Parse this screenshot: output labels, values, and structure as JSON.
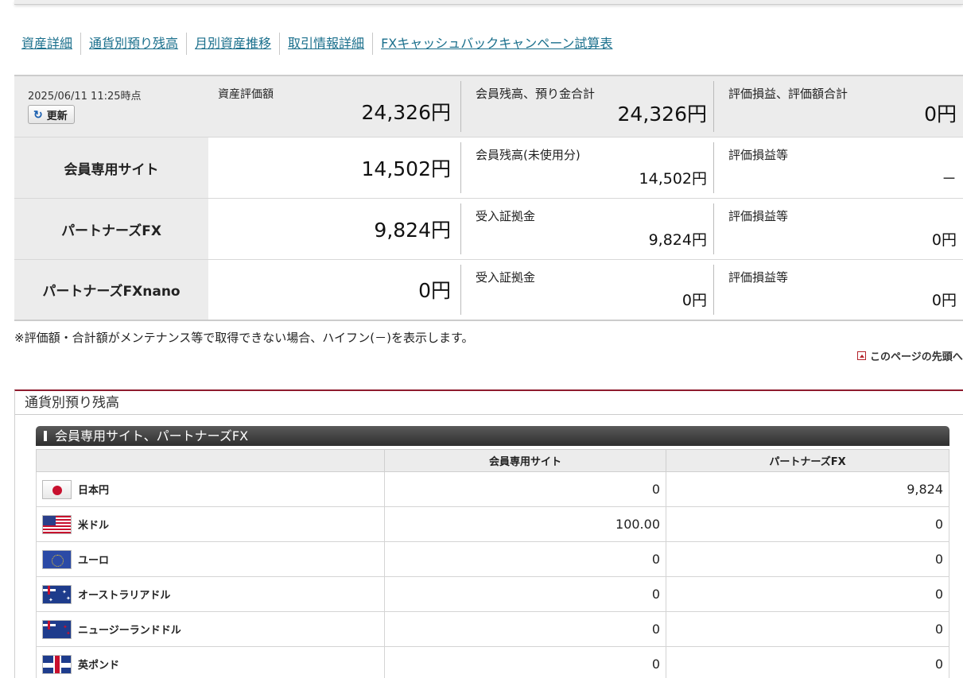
{
  "subnav": [
    "資産詳細",
    "通貨別預り残高",
    "月別資産推移",
    "取引情報詳細",
    "FXキャッシュバックキャンペーン試算表"
  ],
  "summary": {
    "timestamp": "2025/06/11 11:25時点",
    "refresh_label": "更新",
    "total_label": "資産評価額",
    "total_value": "24,326円",
    "balance_label": "会員残高、預り金合計",
    "balance_value": "24,326円",
    "pl_label": "評価損益、評価額合計",
    "pl_value": "0円",
    "rows": [
      {
        "name": "会員専用サイト",
        "value": "14,502円",
        "sub_label": "会員残高(未使用分)",
        "sub_value": "14,502円",
        "pl_label": "評価損益等",
        "pl_value": "－"
      },
      {
        "name": "パートナーズFX",
        "value": "9,824円",
        "sub_label": "受入証拠金",
        "sub_value": "9,824円",
        "pl_label": "評価損益等",
        "pl_value": "0円"
      },
      {
        "name": "パートナーズFXnano",
        "value": "0円",
        "sub_label": "受入証拠金",
        "sub_value": "0円",
        "pl_label": "評価損益等",
        "pl_value": "0円"
      }
    ]
  },
  "note": "※評価額・合計額がメンテナンス等で取得できない場合、ハイフン(－)を表示します。",
  "page_top": "このページの先頭へ",
  "currency_section": {
    "title": "通貨別預り残高",
    "subtitle": "会員専用サイト、パートナーズFX",
    "columns": [
      "",
      "会員専用サイト",
      "パートナーズFX"
    ],
    "rows": [
      {
        "flag": "jp",
        "name": "日本円",
        "site": "0",
        "fx": "9,824"
      },
      {
        "flag": "us",
        "name": "米ドル",
        "site": "100.00",
        "fx": "0"
      },
      {
        "flag": "eu",
        "name": "ユーロ",
        "site": "0",
        "fx": "0"
      },
      {
        "flag": "au",
        "name": "オーストラリアドル",
        "site": "0",
        "fx": "0"
      },
      {
        "flag": "nz",
        "name": "ニュージーランドドル",
        "site": "0",
        "fx": "0"
      },
      {
        "flag": "gb",
        "name": "英ポンド",
        "site": "0",
        "fx": "0"
      }
    ]
  }
}
